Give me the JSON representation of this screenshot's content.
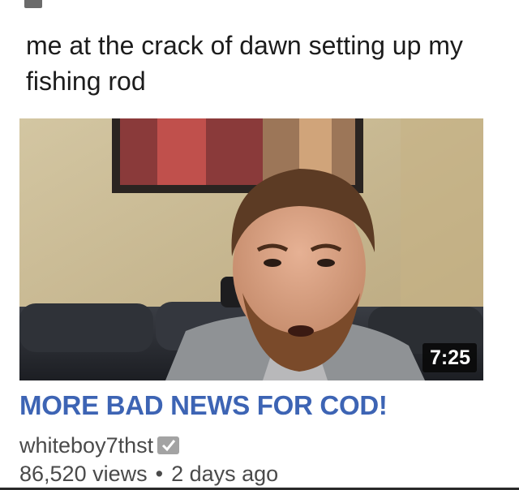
{
  "post": {
    "caption": "me at the crack of dawn setting up my fishing rod"
  },
  "video": {
    "duration": "7:25",
    "title": "MORE BAD NEWS FOR COD!",
    "channel": "whiteboy7thst",
    "views": "86,520 views",
    "separator": "•",
    "age": "2 days ago"
  },
  "colors": {
    "title_link": "#3d64b4",
    "meta_text": "#4a4a4a",
    "duration_bg": "#080808",
    "verified_badge": "#a3a3a3"
  },
  "icons": {
    "verified": "check-badge-icon"
  }
}
